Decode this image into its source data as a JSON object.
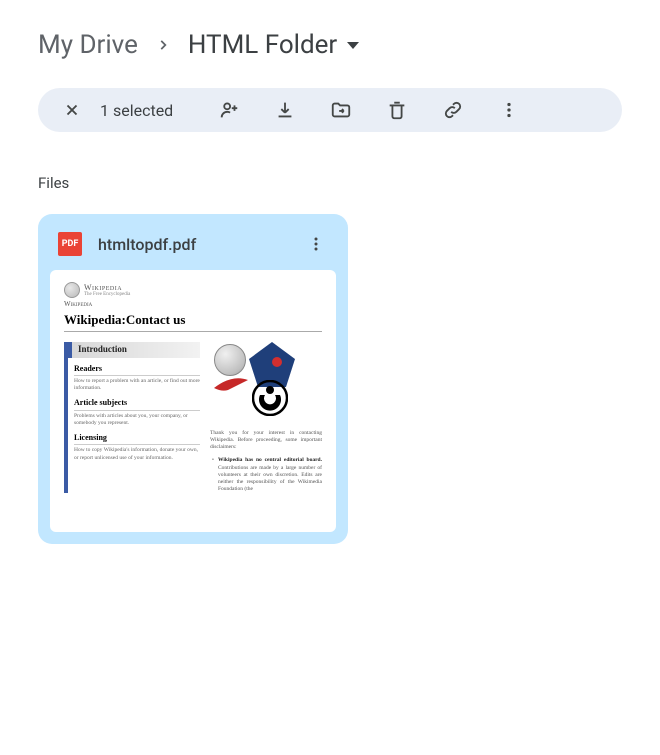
{
  "breadcrumb": {
    "root": "My Drive",
    "current": "HTML Folder"
  },
  "toolbar": {
    "selection_text": "1 selected"
  },
  "section": {
    "label": "Files"
  },
  "file": {
    "badge": "PDF",
    "name": "htmltopdf.pdf"
  },
  "thumb": {
    "logo_main": "Wikipedia",
    "logo_sub": "The Free Encyclopedia",
    "brand_repeat": "Wikipedia",
    "title": "Wikipedia:Contact us",
    "intro": "Introduction",
    "readers_h": "Readers",
    "readers_t": "How to report a problem with an article, or find out more information.",
    "subjects_h": "Article subjects",
    "subjects_t": "Problems with articles about you, your company, or somebody you represent.",
    "licensing_h": "Licensing",
    "licensing_t": "How to copy Wikipedia's information, donate your own, or report unlicensed use of your information.",
    "right_text": "Thank you for your interest in contacting Wikipedia. Before proceeding, some important disclaimers:",
    "bullet_bold": "Wikipedia has no central editorial board.",
    "bullet_rest": " Contributions are made by a large number of volunteers at their own discretion. Edits are neither the responsibility of the Wikimedia Foundation (the"
  }
}
